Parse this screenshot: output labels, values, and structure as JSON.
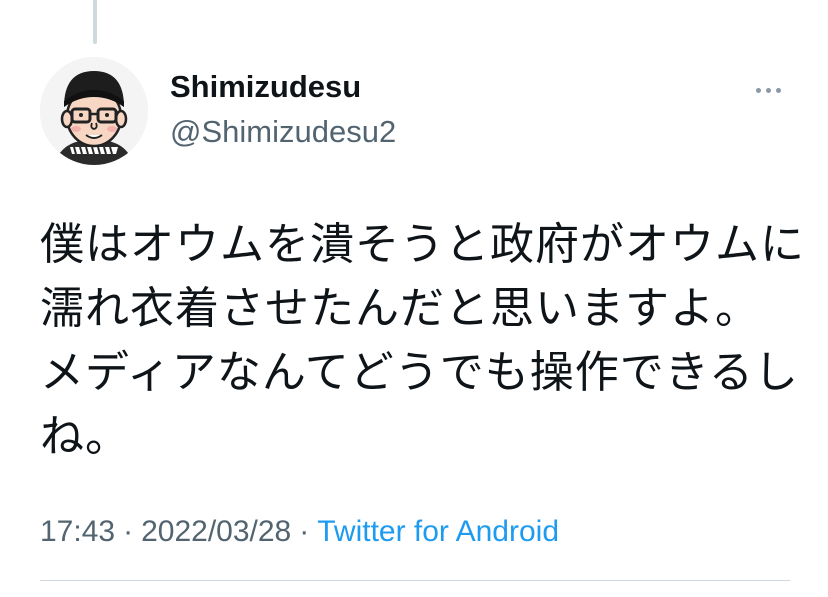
{
  "tweet": {
    "display_name": "Shimizudesu",
    "handle": "@Shimizudesu2",
    "avatar_icon": "cartoon-avatar-glasses-beanie",
    "more_icon": "more-horizontal-icon",
    "text_lines": [
      "僕はオウムを潰そうと政府がオウムに",
      "濡れ衣着させたんだと思いますよ。",
      "メディアなんてどうでも操作できるし",
      "ね。"
    ],
    "time": "17:43",
    "date": "2022/03/28",
    "separator": "·",
    "source": "Twitter for Android"
  },
  "colors": {
    "text_primary": "#0f1419",
    "text_secondary": "#536471",
    "link": "#1d9bf0",
    "divider": "#cfd9de"
  }
}
